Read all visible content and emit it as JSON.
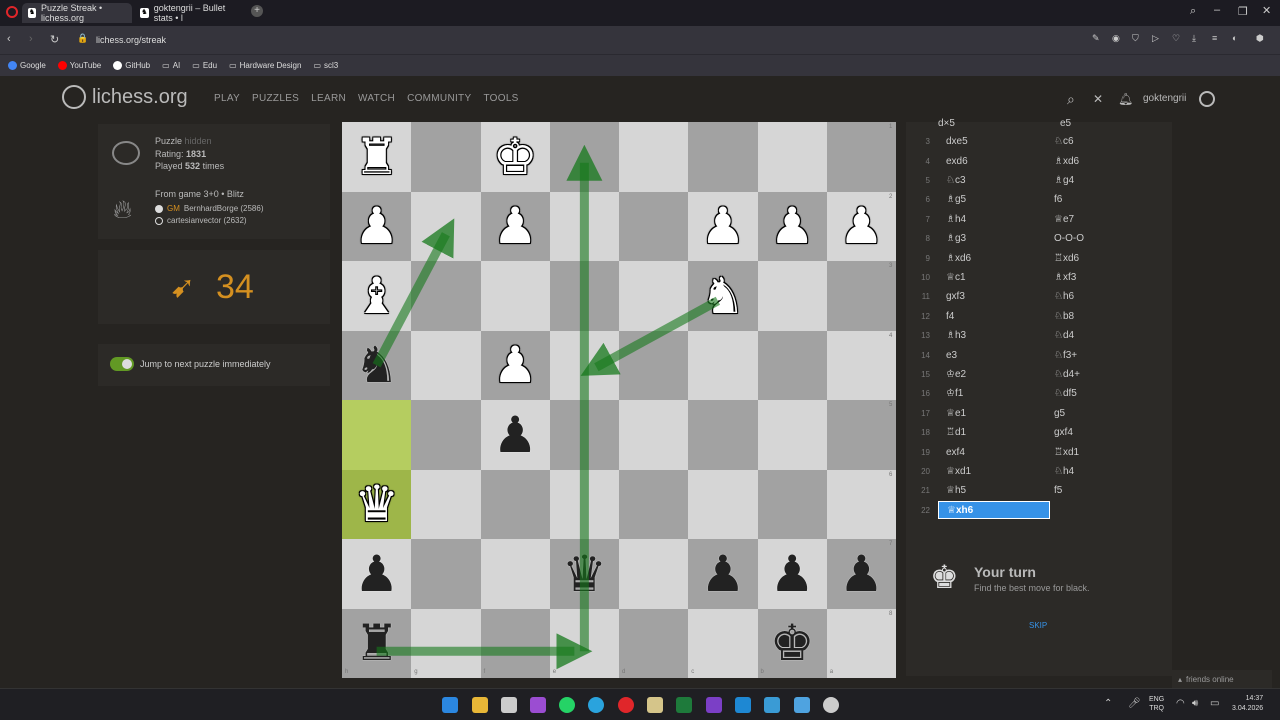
{
  "browser": {
    "tabs": [
      "Puzzle Streak • lichess.org",
      "goktengrii – Bullet stats • l"
    ],
    "url": "lichess.org/streak",
    "bookmarks": [
      "Google",
      "YouTube",
      "GitHub",
      "AI",
      "Edu",
      "Hardware Design",
      "scl3"
    ]
  },
  "header": {
    "logo": "lichess.org",
    "nav": [
      "PLAY",
      "PUZZLES",
      "LEARN",
      "WATCH",
      "COMMUNITY",
      "TOOLS"
    ],
    "username": "goktengrii"
  },
  "puzzle": {
    "title": "Puzzle",
    "hidden": "hidden",
    "rating_label": "Rating:",
    "rating": "1831",
    "played_pre": "Played",
    "played_count": "532",
    "played_post": "times",
    "game_info": "From game 3+0 • Blitz",
    "white_title": "GM",
    "white_player": "BernhardBorge (2586)",
    "black_player": "cartesianvector (2632)"
  },
  "streak": {
    "count": "34"
  },
  "jump": {
    "label": "Jump to next puzzle immediately",
    "enabled": true
  },
  "board": {
    "files": [
      "h",
      "g",
      "f",
      "e",
      "d",
      "c",
      "b",
      "a"
    ],
    "ranks": [
      "1",
      "2",
      "3",
      "4",
      "5",
      "6",
      "7",
      "8"
    ]
  },
  "moves": [
    {
      "n": "3",
      "w": "dxe5",
      "b": "♘c6"
    },
    {
      "n": "4",
      "w": "exd6",
      "b": "♗xd6"
    },
    {
      "n": "5",
      "w": "♘c3",
      "b": "♗g4"
    },
    {
      "n": "6",
      "w": "♗g5",
      "b": "f6"
    },
    {
      "n": "7",
      "w": "♗h4",
      "b": "♕e7"
    },
    {
      "n": "8",
      "w": "♗g3",
      "b": "O-O-O"
    },
    {
      "n": "9",
      "w": "♗xd6",
      "b": "♖xd6"
    },
    {
      "n": "10",
      "w": "♕c1",
      "b": "♗xf3"
    },
    {
      "n": "11",
      "w": "gxf3",
      "b": "♘h6"
    },
    {
      "n": "12",
      "w": "f4",
      "b": "♘b8"
    },
    {
      "n": "13",
      "w": "♗h3",
      "b": "♘d4"
    },
    {
      "n": "14",
      "w": "e3",
      "b": "♘f3+"
    },
    {
      "n": "15",
      "w": "♔e2",
      "b": "♘d4+"
    },
    {
      "n": "16",
      "w": "♔f1",
      "b": "♘df5"
    },
    {
      "n": "17",
      "w": "♕e1",
      "b": "g5"
    },
    {
      "n": "18",
      "w": "♖d1",
      "b": "gxf4"
    },
    {
      "n": "19",
      "w": "exf4",
      "b": "♖xd1"
    },
    {
      "n": "20",
      "w": "♕xd1",
      "b": "♘h4"
    },
    {
      "n": "21",
      "w": "♕h5",
      "b": "f5"
    },
    {
      "n": "22",
      "w": "♕xh6",
      "b": ""
    }
  ],
  "turn": {
    "title": "Your turn",
    "subtitle": "Find the best move for black.",
    "skip": "SKIP"
  },
  "footer": {
    "friends": "friends online",
    "lang": "ENG",
    "kbd": "TRQ",
    "time": "14:37",
    "date": "3.04.2026"
  }
}
